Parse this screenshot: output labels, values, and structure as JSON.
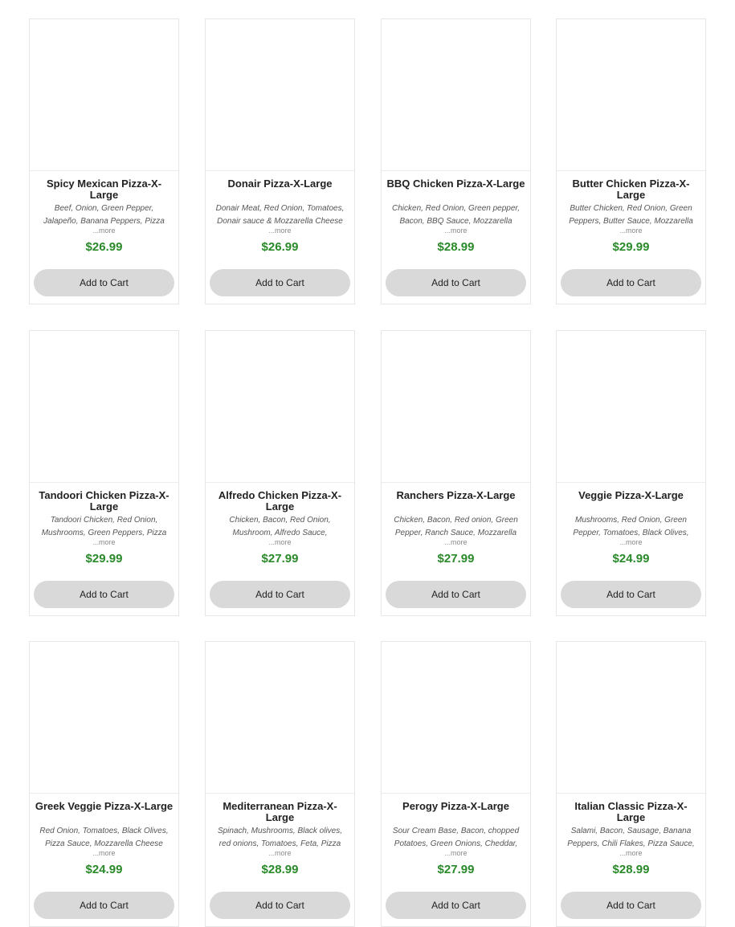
{
  "products": [
    {
      "name": "Spicy Mexican Pizza-X-Large",
      "description": "Beef, Onion, Green Pepper, Jalapeño, Banana Peppers, Pizza",
      "more": "...more",
      "price": "$26.99",
      "cart_label": "Add to Cart"
    },
    {
      "name": "Donair Pizza-X-Large",
      "description": "Donair Meat, Red Onion, Tomatoes, Donair sauce & Mozzarella Cheese",
      "more": "...more",
      "price": "$26.99",
      "cart_label": "Add to Cart"
    },
    {
      "name": "BBQ Chicken Pizza-X-Large",
      "description": "Chicken, Red Onion, Green pepper, Bacon, BBQ Sauce, Mozzarella",
      "more": "...more",
      "price": "$28.99",
      "cart_label": "Add to Cart"
    },
    {
      "name": "Butter Chicken Pizza-X-Large",
      "description": "Butter Chicken, Red Onion, Green Peppers, Butter Sauce, Mozzarella",
      "more": "...more",
      "price": "$29.99",
      "cart_label": "Add to Cart"
    },
    {
      "name": "Tandoori Chicken Pizza-X-Large",
      "description": "Tandoori Chicken, Red Onion, Mushrooms, Green Peppers, Pizza",
      "more": "...more",
      "price": "$29.99",
      "cart_label": "Add to Cart"
    },
    {
      "name": "Alfredo Chicken Pizza-X-Large",
      "description": "Chicken, Bacon, Red Onion, Mushroom, Alfredo Sauce,",
      "more": "...more",
      "price": "$27.99",
      "cart_label": "Add to Cart"
    },
    {
      "name": "Ranchers Pizza-X-Large",
      "description": "Chicken, Bacon, Red onion, Green Pepper, Ranch Sauce, Mozzarella",
      "more": "...more",
      "price": "$27.99",
      "cart_label": "Add to Cart"
    },
    {
      "name": "Veggie Pizza-X-Large",
      "description": "Mushrooms, Red Onion, Green Pepper, Tomatoes, Black Olives,",
      "more": "...more",
      "price": "$24.99",
      "cart_label": "Add to Cart"
    },
    {
      "name": "Greek Veggie Pizza-X-Large",
      "description": "Red Onion, Tomatoes, Black Olives, Pizza Sauce, Mozzarella Cheese",
      "more": "...more",
      "price": "$24.99",
      "cart_label": "Add to Cart"
    },
    {
      "name": "Mediterranean Pizza-X-Large",
      "description": "Spinach, Mushrooms, Black olives, red onions, Tomatoes, Feta, Pizza",
      "more": "...more",
      "price": "$28.99",
      "cart_label": "Add to Cart"
    },
    {
      "name": "Perogy Pizza-X-Large",
      "description": "Sour Cream Base, Bacon, chopped Potatoes, Green Onions, Cheddar,",
      "more": "...more",
      "price": "$27.99",
      "cart_label": "Add to Cart"
    },
    {
      "name": "Italian Classic Pizza-X-Large",
      "description": "Salami, Bacon, Sausage, Banana Peppers, Chili Flakes, Pizza Sauce,",
      "more": "...more",
      "price": "$28.99",
      "cart_label": "Add to Cart"
    }
  ],
  "colors": {
    "price": "#2a8a2a",
    "button": "#d9d9d9",
    "border": "#e6e6e6"
  }
}
